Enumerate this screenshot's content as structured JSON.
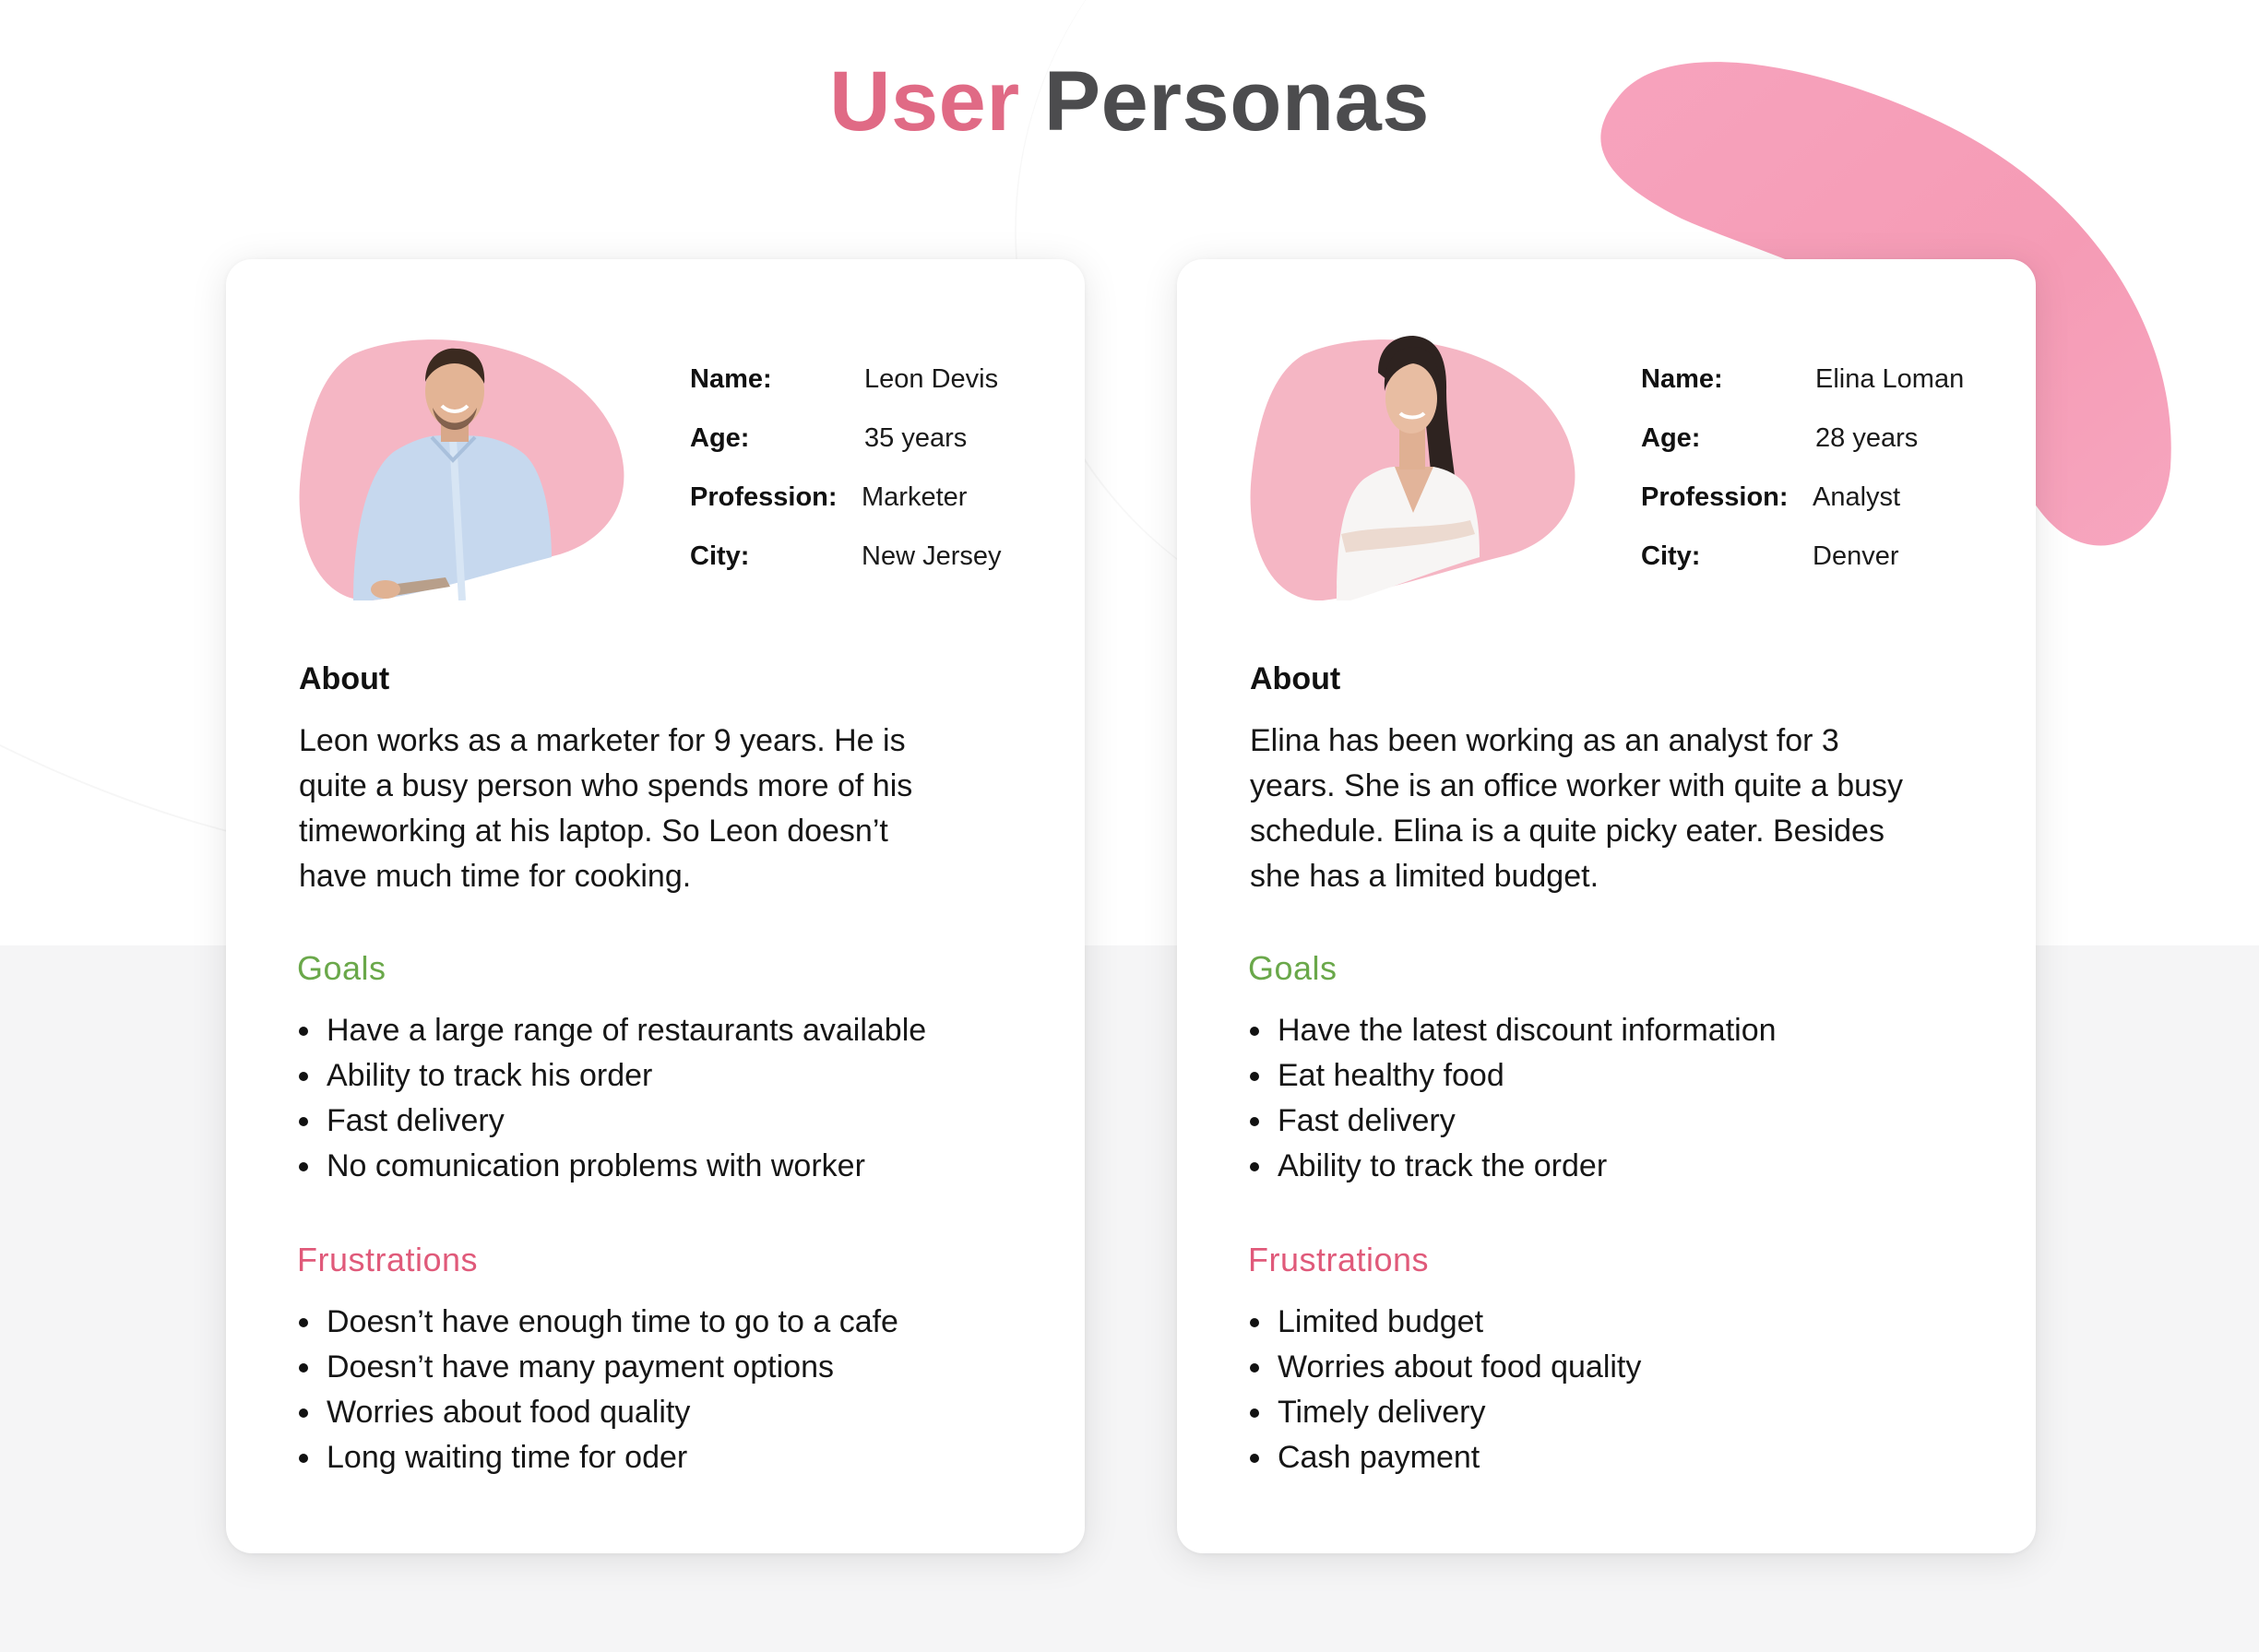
{
  "title": {
    "part1": "User",
    "part2": "Personas"
  },
  "colors": {
    "title_accent": "#e06a85",
    "title_main": "#4c4c4e",
    "goals_heading": "#6aa84a",
    "frustrations_heading": "#e05a7a",
    "avatar_blob": "#f5b6c4",
    "decor_blob": "#f7a1bb"
  },
  "personas": [
    {
      "avatar": "man-in-blue-shirt-photo",
      "info": [
        {
          "label": "Name:",
          "value": "Leon Devis"
        },
        {
          "label": "Age:",
          "value": "35 years"
        },
        {
          "label": "Profession:",
          "value": "Marketer"
        },
        {
          "label": "City:",
          "value": "New Jersey"
        }
      ],
      "about_heading": "About",
      "about_lines": [
        "Leon works as a marketer for 9 years. He is",
        "quite a busy person who spends more of his",
        "timeworking at his laptop. So Leon doesn’t",
        "have much time for cooking."
      ],
      "goals_heading": "Goals",
      "goals": [
        "Have a large range of restaurants available",
        "Ability to track his order",
        "Fast delivery",
        "No comunication problems with worker"
      ],
      "frustrations_heading": "Frustrations",
      "frustrations": [
        "Doesn’t have enough time to go to a cafe",
        "Doesn’t have many payment options",
        "Worries about food quality",
        "Long waiting time for oder"
      ]
    },
    {
      "avatar": "woman-in-white-top-photo",
      "info": [
        {
          "label": "Name:",
          "value": "Elina Loman"
        },
        {
          "label": "Age:",
          "value": "28 years"
        },
        {
          "label": "Profession:",
          "value": "Analyst"
        },
        {
          "label": "City:",
          "value": "Denver"
        }
      ],
      "about_heading": "About",
      "about_lines": [
        "Elina has been working as an analyst for 3",
        "years. She is an office worker with quite a busy",
        "schedule. Elina is a quite picky eater. Besides",
        "she has a limited budget."
      ],
      "goals_heading": "Goals",
      "goals": [
        "Have the latest discount information",
        "Eat healthy food",
        "Fast delivery",
        "Ability to track the order"
      ],
      "frustrations_heading": "Frustrations",
      "frustrations": [
        "Limited budget",
        "Worries about food quality",
        "Timely delivery",
        "Cash payment"
      ]
    }
  ]
}
